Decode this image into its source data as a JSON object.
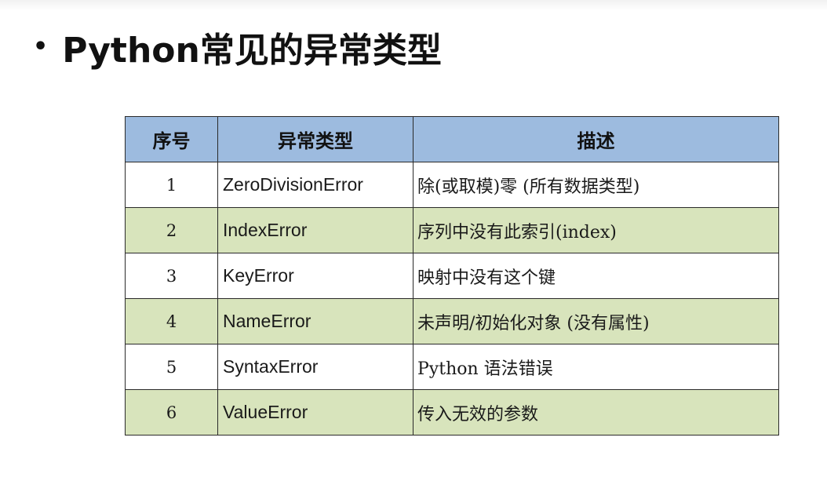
{
  "slide": {
    "bullet": "•",
    "title": "Python常见的异常类型"
  },
  "table": {
    "headers": [
      "序号",
      "异常类型",
      "描述"
    ],
    "rows": [
      {
        "index": "1",
        "type": "ZeroDivisionError",
        "description": "除(或取模)零 (所有数据类型)"
      },
      {
        "index": "2",
        "type": "IndexError",
        "description": "序列中没有此索引(index)"
      },
      {
        "index": "3",
        "type": "KeyError",
        "description": "映射中没有这个键"
      },
      {
        "index": "4",
        "type": "NameError",
        "description": "未声明/初始化对象 (没有属性)"
      },
      {
        "index": "5",
        "type": "SyntaxError",
        "description": "Python 语法错误"
      },
      {
        "index": "6",
        "type": "ValueError",
        "description": "传入无效的参数"
      }
    ]
  },
  "colors": {
    "header_bg": "#9dbbdf",
    "stripe_bg": "#d8e4bc"
  }
}
